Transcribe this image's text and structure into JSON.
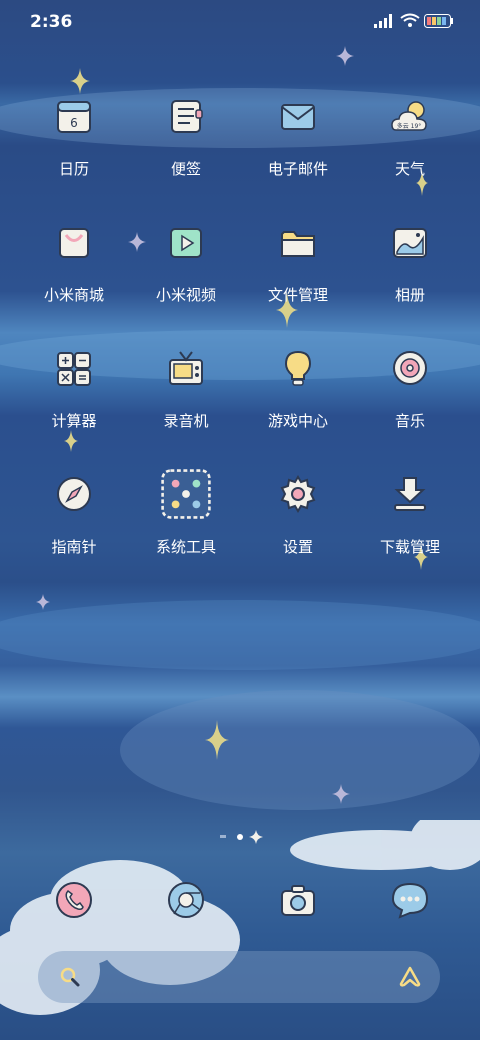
{
  "status_bar": {
    "time": "2:36"
  },
  "apps": [
    {
      "label": "日历",
      "icon": "calendar-icon",
      "extra": "6"
    },
    {
      "label": "便签",
      "icon": "notes-icon"
    },
    {
      "label": "电子邮件",
      "icon": "email-icon"
    },
    {
      "label": "天气",
      "icon": "weather-icon",
      "extra": "多云 19°"
    },
    {
      "label": "小米商城",
      "icon": "mi-store-icon"
    },
    {
      "label": "小米视频",
      "icon": "mi-video-icon"
    },
    {
      "label": "文件管理",
      "icon": "folder-icon"
    },
    {
      "label": "相册",
      "icon": "gallery-icon"
    },
    {
      "label": "计算器",
      "icon": "calculator-icon"
    },
    {
      "label": "录音机",
      "icon": "recorder-icon"
    },
    {
      "label": "游戏中心",
      "icon": "lightbulb-icon"
    },
    {
      "label": "音乐",
      "icon": "music-disc-icon"
    },
    {
      "label": "指南针",
      "icon": "compass-icon"
    },
    {
      "label": "系统工具",
      "icon": "folder-grid-icon"
    },
    {
      "label": "设置",
      "icon": "gear-icon"
    },
    {
      "label": "下载管理",
      "icon": "download-icon"
    }
  ],
  "dock": [
    {
      "icon": "phone-icon"
    },
    {
      "icon": "browser-icon"
    },
    {
      "icon": "camera-icon"
    },
    {
      "icon": "message-icon"
    }
  ],
  "colors": {
    "icon_fill": "#f3f1ea",
    "accent_pink": "#f2a7b8",
    "accent_yellow": "#f7dc86",
    "accent_blue": "#9ccbe8",
    "sparkle": "#d9d08a"
  }
}
